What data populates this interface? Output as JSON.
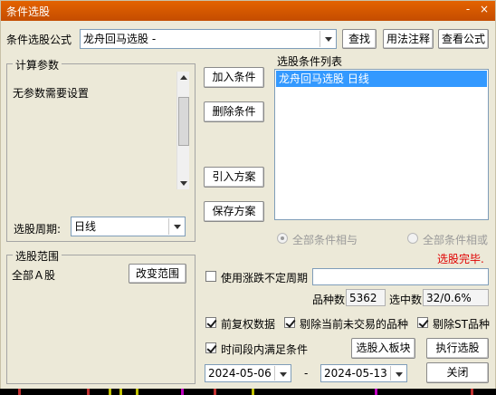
{
  "window": {
    "title": "条件选股",
    "minimize": "-",
    "close": "×"
  },
  "formula": {
    "label": "条件选股公式",
    "value": "龙舟回马选股  -",
    "find": "查找",
    "usage": "用法注释",
    "view": "查看公式"
  },
  "params": {
    "title": "计算参数",
    "text": "无参数需要设置"
  },
  "period": {
    "label": "选股周期:",
    "value": "日线"
  },
  "scope": {
    "title": "选股范围",
    "value": "全部Ａ股",
    "change": "改变范围"
  },
  "actions": {
    "add": "加入条件",
    "delete": "删除条件",
    "import": "引入方案",
    "save": "保存方案"
  },
  "conditions": {
    "title": "选股条件列表",
    "items": [
      "龙舟回马选股  日线"
    ]
  },
  "logic": {
    "and": "全部条件相与",
    "or": "全部条件相或",
    "selected": "and"
  },
  "status": {
    "text": "选股完毕.",
    "color": "#e00000"
  },
  "volatile": {
    "label": "使用涨跌不定周期",
    "value": "",
    "checked": false
  },
  "counts": {
    "total_label": "品种数",
    "total": "5362",
    "hit_label": "选中数",
    "hit": "32/0.6%"
  },
  "options": {
    "adjust": {
      "label": "前复权数据",
      "checked": true
    },
    "exclude_untraded": {
      "label": "剔除当前未交易的品种",
      "checked": true
    },
    "exclude_st": {
      "label": "剔除ST品种",
      "checked": true
    },
    "time_range": {
      "label": "时间段内满足条件",
      "checked": true
    }
  },
  "dates": {
    "from": "2024-05-06",
    "sep": "-",
    "to": "2024-05-13"
  },
  "buttons": {
    "to_block": "选股入板块",
    "run": "执行选股",
    "close": "关闭"
  }
}
